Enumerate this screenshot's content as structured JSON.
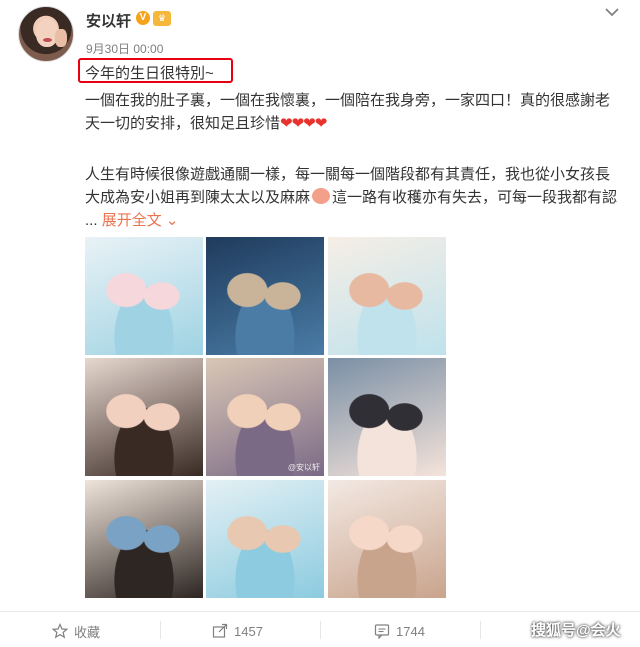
{
  "user": {
    "name": "安以轩",
    "verified_badge": "V",
    "timestamp": "9月30日 00:00"
  },
  "post": {
    "lines": [
      "今年的生日很特別~",
      "一個在我的肚子裏，一個在我懷裏，一個陪在我身旁，一家四口！真的很感謝老",
      "天一切的安排，很知足且珍惜",
      "人生有時候很像遊戲通關一樣，每一關每一個階段都有其責任，我也從小女孩長",
      "大成為安小姐再到陳太太以及麻麻",
      "這一路有收穫亦有失去，可每一段我都有認"
    ],
    "hearts": "❤❤❤❤",
    "ellipsis": "...",
    "expand_label": "展开全文",
    "expand_chevron": "⌄"
  },
  "photos": [
    {
      "name": "photo-1",
      "colors": [
        "#e9f2f6",
        "#9fd3e3",
        "#f5d7dc"
      ],
      "watermark": ""
    },
    {
      "name": "photo-2",
      "colors": [
        "#1f3b5c",
        "#4a7ca6",
        "#c9b49a"
      ],
      "watermark": ""
    },
    {
      "name": "photo-3",
      "colors": [
        "#f6eee6",
        "#bfe2ec",
        "#e7b9a1"
      ],
      "watermark": ""
    },
    {
      "name": "photo-4",
      "colors": [
        "#e6d7cf",
        "#3a2a24",
        "#f2d0bf"
      ],
      "watermark": ""
    },
    {
      "name": "photo-5",
      "colors": [
        "#d9c7b6",
        "#7b6a86",
        "#f1d0b9"
      ],
      "watermark": "@安以轩"
    },
    {
      "name": "photo-6",
      "colors": [
        "#7a8fa5",
        "#f4e3da",
        "#2f2f35"
      ],
      "watermark": ""
    },
    {
      "name": "photo-7",
      "colors": [
        "#efe4da",
        "#2e2623",
        "#7aa2c4"
      ],
      "watermark": ""
    },
    {
      "name": "photo-8",
      "colors": [
        "#e3f0f4",
        "#8ccbe0",
        "#e8c8b0"
      ],
      "watermark": ""
    },
    {
      "name": "photo-9",
      "colors": [
        "#f3e9e3",
        "#c9a48d",
        "#f6d8c8"
      ],
      "watermark": ""
    }
  ],
  "actions": {
    "favorite_label": "收藏",
    "repost_count": "1457",
    "comment_count": "1744"
  },
  "source_watermark": "搜狐号@会火",
  "colors": {
    "accent": "#eb7350",
    "highlight_border": "#e60012",
    "heart": "#e8322e",
    "badge": "#f7a21b"
  }
}
